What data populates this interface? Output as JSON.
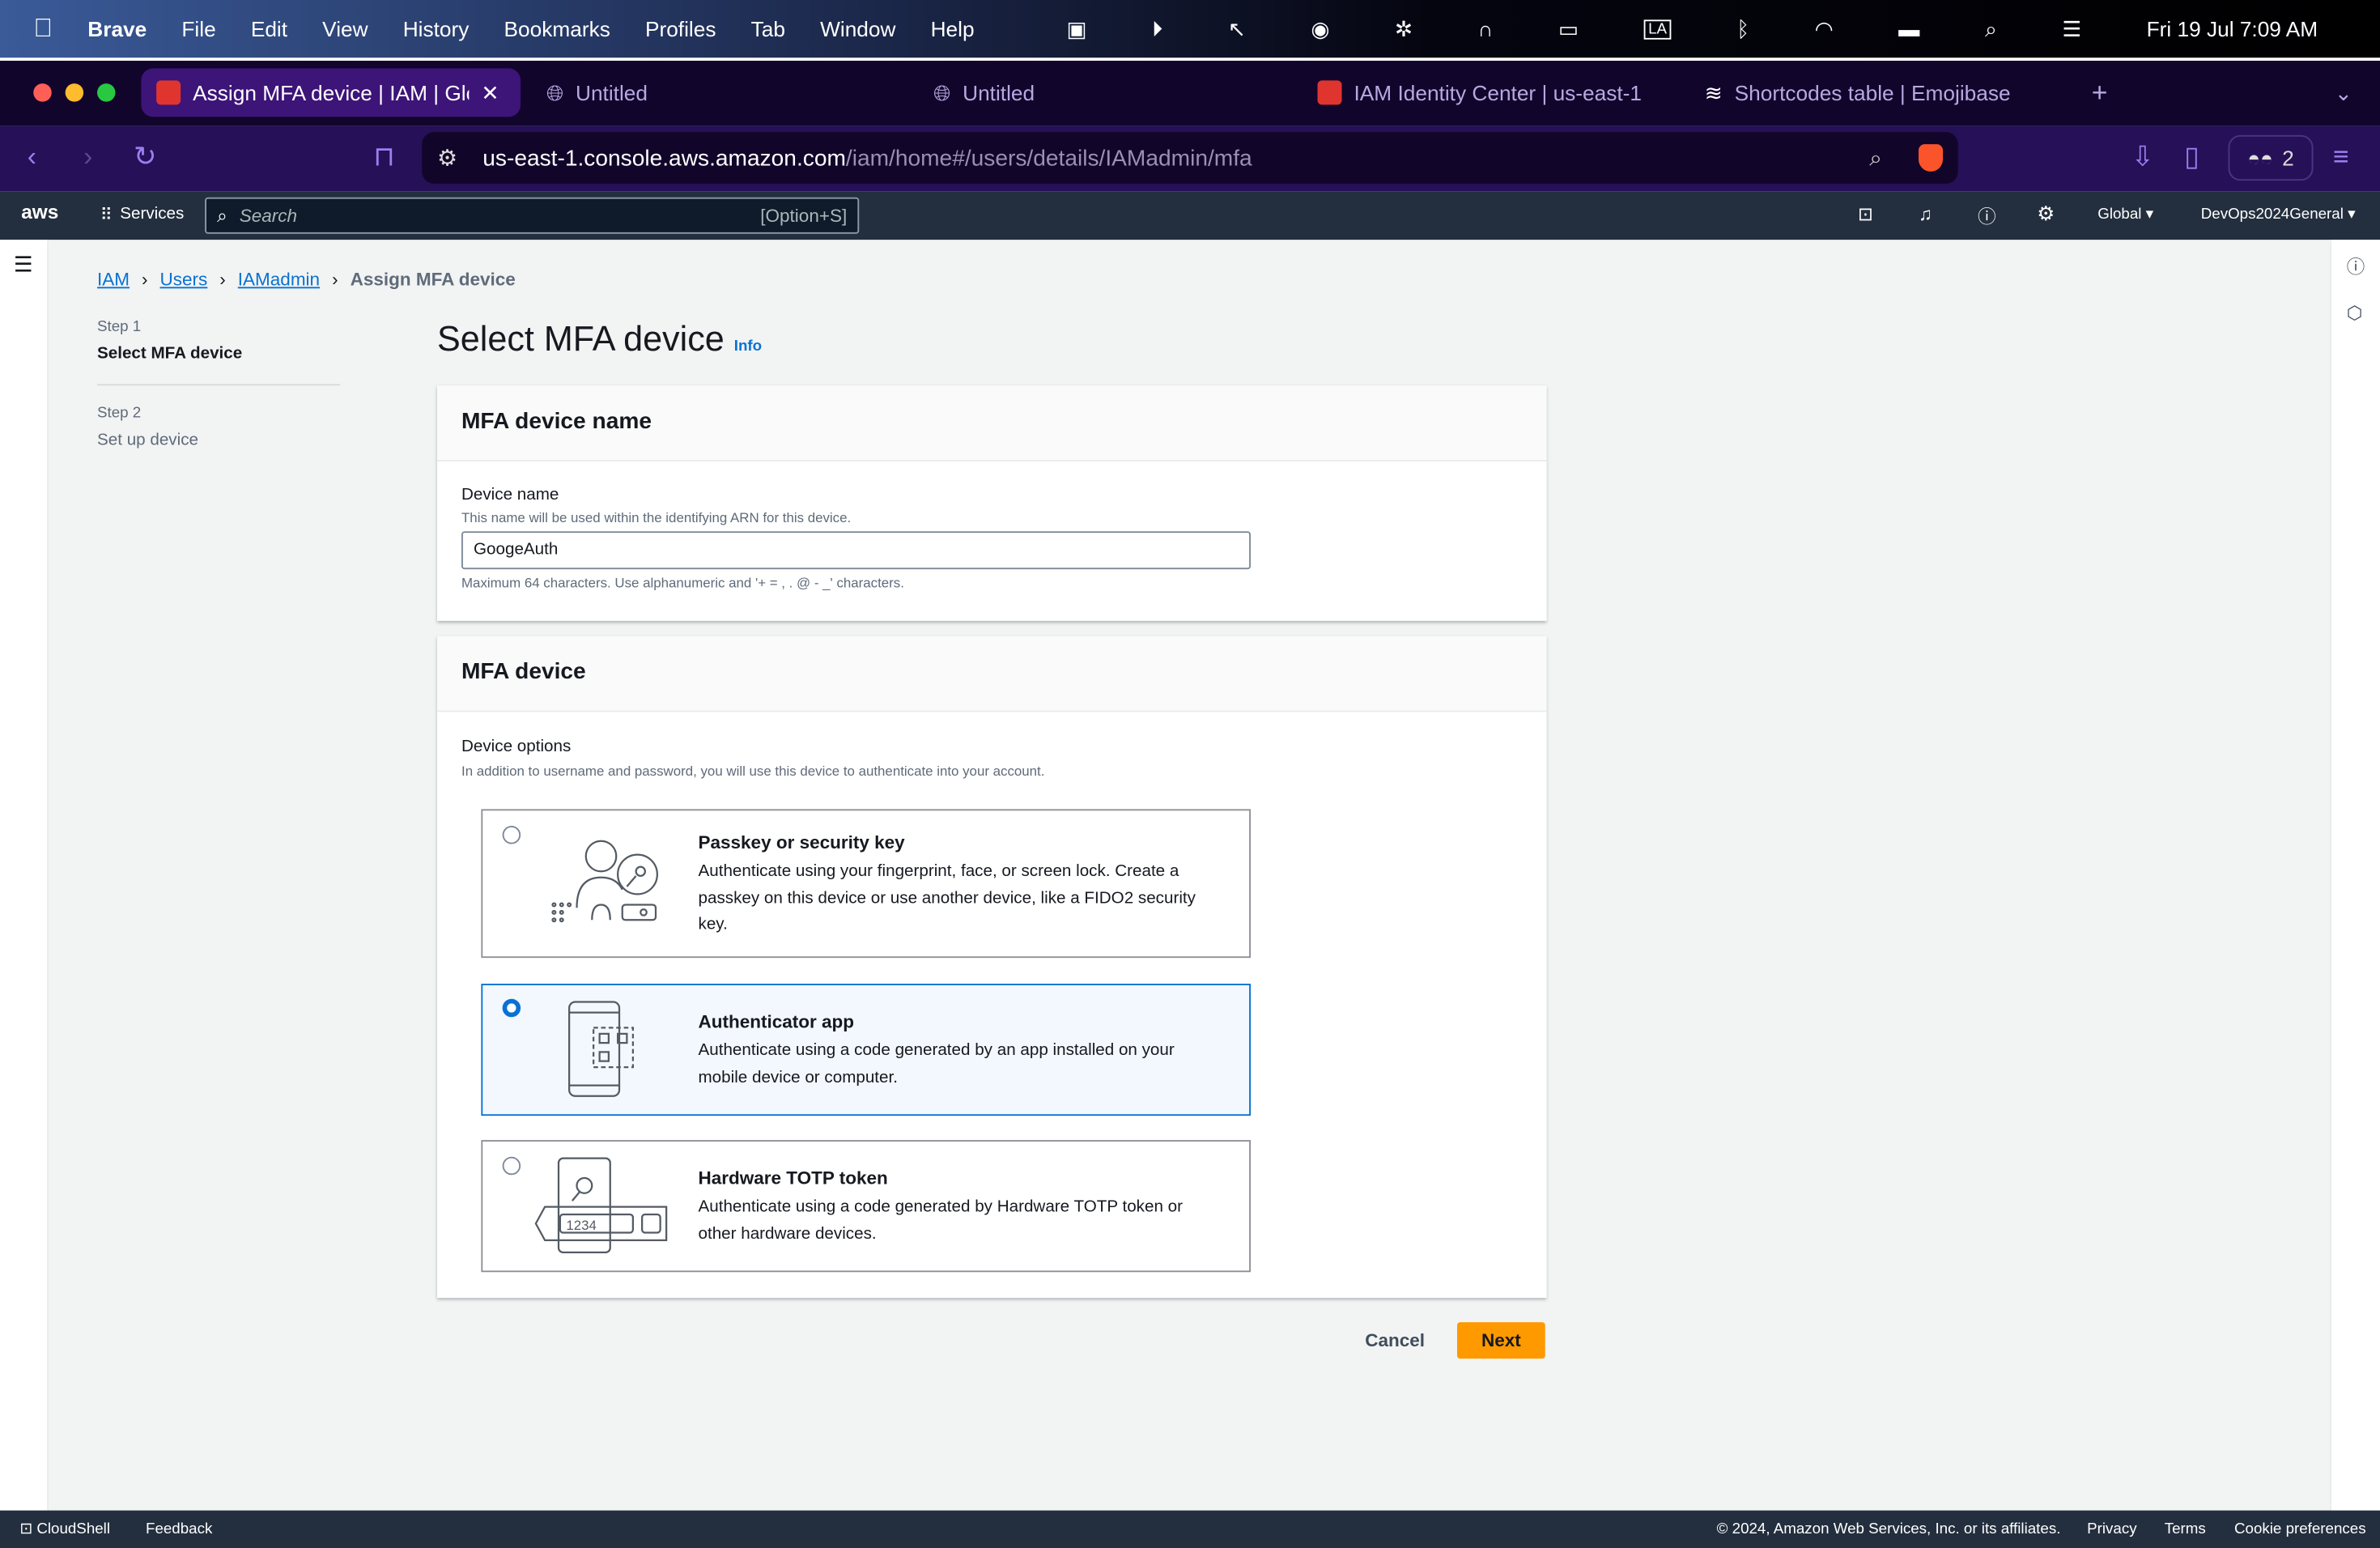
{
  "menubar": {
    "app": "Brave",
    "items": [
      "File",
      "Edit",
      "View",
      "History",
      "Bookmarks",
      "Profiles",
      "Tab",
      "Window",
      "Help"
    ],
    "clock": "Fri 19 Jul  7:09 AM"
  },
  "tabs": [
    {
      "title": "Assign MFA device | IAM | Glo",
      "active": true
    },
    {
      "title": "Untitled"
    },
    {
      "title": "Untitled"
    },
    {
      "title": "IAM Identity Center | us-east-1"
    },
    {
      "title": "Shortcodes table | Emojibase"
    }
  ],
  "address": {
    "host": "us-east-1.console.aws.amazon.com",
    "path": "/iam/home#/users/details/IAMadmin/mfa",
    "brave_badge": "1",
    "vpn_count": "2"
  },
  "awsnav": {
    "logo": "aws",
    "services": "Services",
    "search_placeholder": "Search",
    "shortcut": "[Option+S]",
    "region": "Global",
    "account": "DevOps2024General"
  },
  "breadcrumb": [
    "IAM",
    "Users",
    "IAMadmin",
    "Assign MFA device"
  ],
  "steps": [
    {
      "step": "Step 1",
      "label": "Select MFA device"
    },
    {
      "step": "Step 2",
      "label": "Set up device"
    }
  ],
  "page": {
    "title": "Select MFA device",
    "info": "Info"
  },
  "name_card": {
    "header": "MFA device name",
    "label": "Device name",
    "description": "This name will be used within the identifying ARN for this device.",
    "value": "GoogeAuth",
    "constraint": "Maximum 64 characters. Use alphanumeric and '+ = , . @ - _' characters."
  },
  "device_card": {
    "header": "MFA device",
    "label": "Device options",
    "description": "In addition to username and password, you will use this device to authenticate into your account.",
    "options": [
      {
        "title": "Passkey or security key",
        "description": "Authenticate using your fingerprint, face, or screen lock. Create a passkey on this device or use another device, like a FIDO2 security key.",
        "selected": false
      },
      {
        "title": "Authenticator app",
        "description": "Authenticate using a code generated by an app installed on your mobile device or computer.",
        "selected": true
      },
      {
        "title": "Hardware TOTP token",
        "description": "Authenticate using a code generated by Hardware TOTP token or other hardware devices.",
        "selected": false,
        "token_digits": "1234"
      }
    ]
  },
  "actions": {
    "cancel": "Cancel",
    "next": "Next"
  },
  "footer": {
    "cloudshell": "CloudShell",
    "feedback": "Feedback",
    "copyright": "© 2024, Amazon Web Services, Inc. or its affiliates.",
    "privacy": "Privacy",
    "terms": "Terms",
    "cookies": "Cookie preferences"
  },
  "colors": {
    "accent": "#0972d3",
    "next": "#ff9900",
    "aws_nav": "#232f3e"
  }
}
